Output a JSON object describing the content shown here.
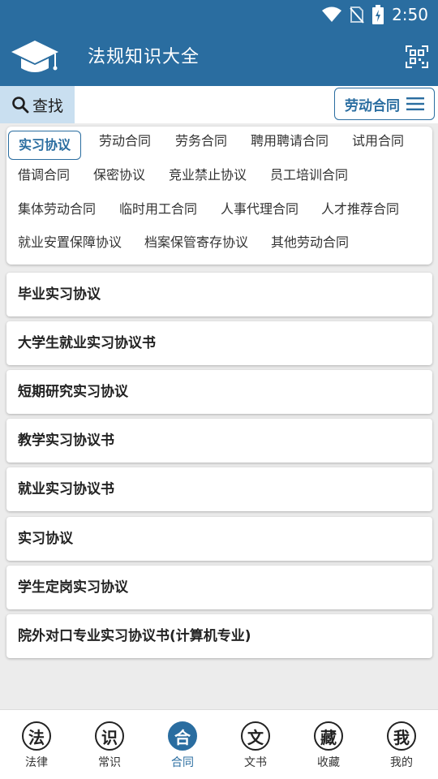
{
  "status_bar": {
    "time": "2:50"
  },
  "app_bar": {
    "title": "法规知识大全"
  },
  "search": {
    "label": "查找"
  },
  "category_button": {
    "label": "劳动合同"
  },
  "tags": [
    {
      "label": "实习协议",
      "active": true
    },
    {
      "label": "劳动合同",
      "active": false
    },
    {
      "label": "劳务合同",
      "active": false
    },
    {
      "label": "聘用聘请合同",
      "active": false
    },
    {
      "label": "试用合同",
      "active": false
    },
    {
      "label": "借调合同",
      "active": false
    },
    {
      "label": "保密协议",
      "active": false
    },
    {
      "label": "竞业禁止协议",
      "active": false
    },
    {
      "label": "员工培训合同",
      "active": false
    },
    {
      "label": "集体劳动合同",
      "active": false
    },
    {
      "label": "临时用工合同",
      "active": false
    },
    {
      "label": "人事代理合同",
      "active": false
    },
    {
      "label": "人才推荐合同",
      "active": false
    },
    {
      "label": "就业安置保障协议",
      "active": false
    },
    {
      "label": "档案保管寄存协议",
      "active": false
    },
    {
      "label": "其他劳动合同",
      "active": false
    }
  ],
  "documents": [
    "毕业实习协议",
    "大学生就业实习协议书",
    "短期研究实习协议",
    "教学实习协议书",
    "就业实习协议书",
    "实习协议",
    "学生定岗实习协议",
    "院外对口专业实习协议书(计算机专业)"
  ],
  "bottom_nav": [
    {
      "glyph": "法",
      "label": "法律",
      "active": false
    },
    {
      "glyph": "识",
      "label": "常识",
      "active": false
    },
    {
      "glyph": "合",
      "label": "合同",
      "active": true
    },
    {
      "glyph": "文",
      "label": "文书",
      "active": false
    },
    {
      "glyph": "藏",
      "label": "收藏",
      "active": false
    },
    {
      "glyph": "我",
      "label": "我的",
      "active": false
    }
  ],
  "colors": {
    "primary": "#2a6da0",
    "search_bg": "#c9dff0",
    "page_bg": "#ececec"
  },
  "icons": [
    "wifi-icon",
    "no-sim-icon",
    "battery-charging-icon",
    "graduation-cap-icon",
    "qr-scan-icon",
    "search-icon",
    "menu-icon"
  ]
}
